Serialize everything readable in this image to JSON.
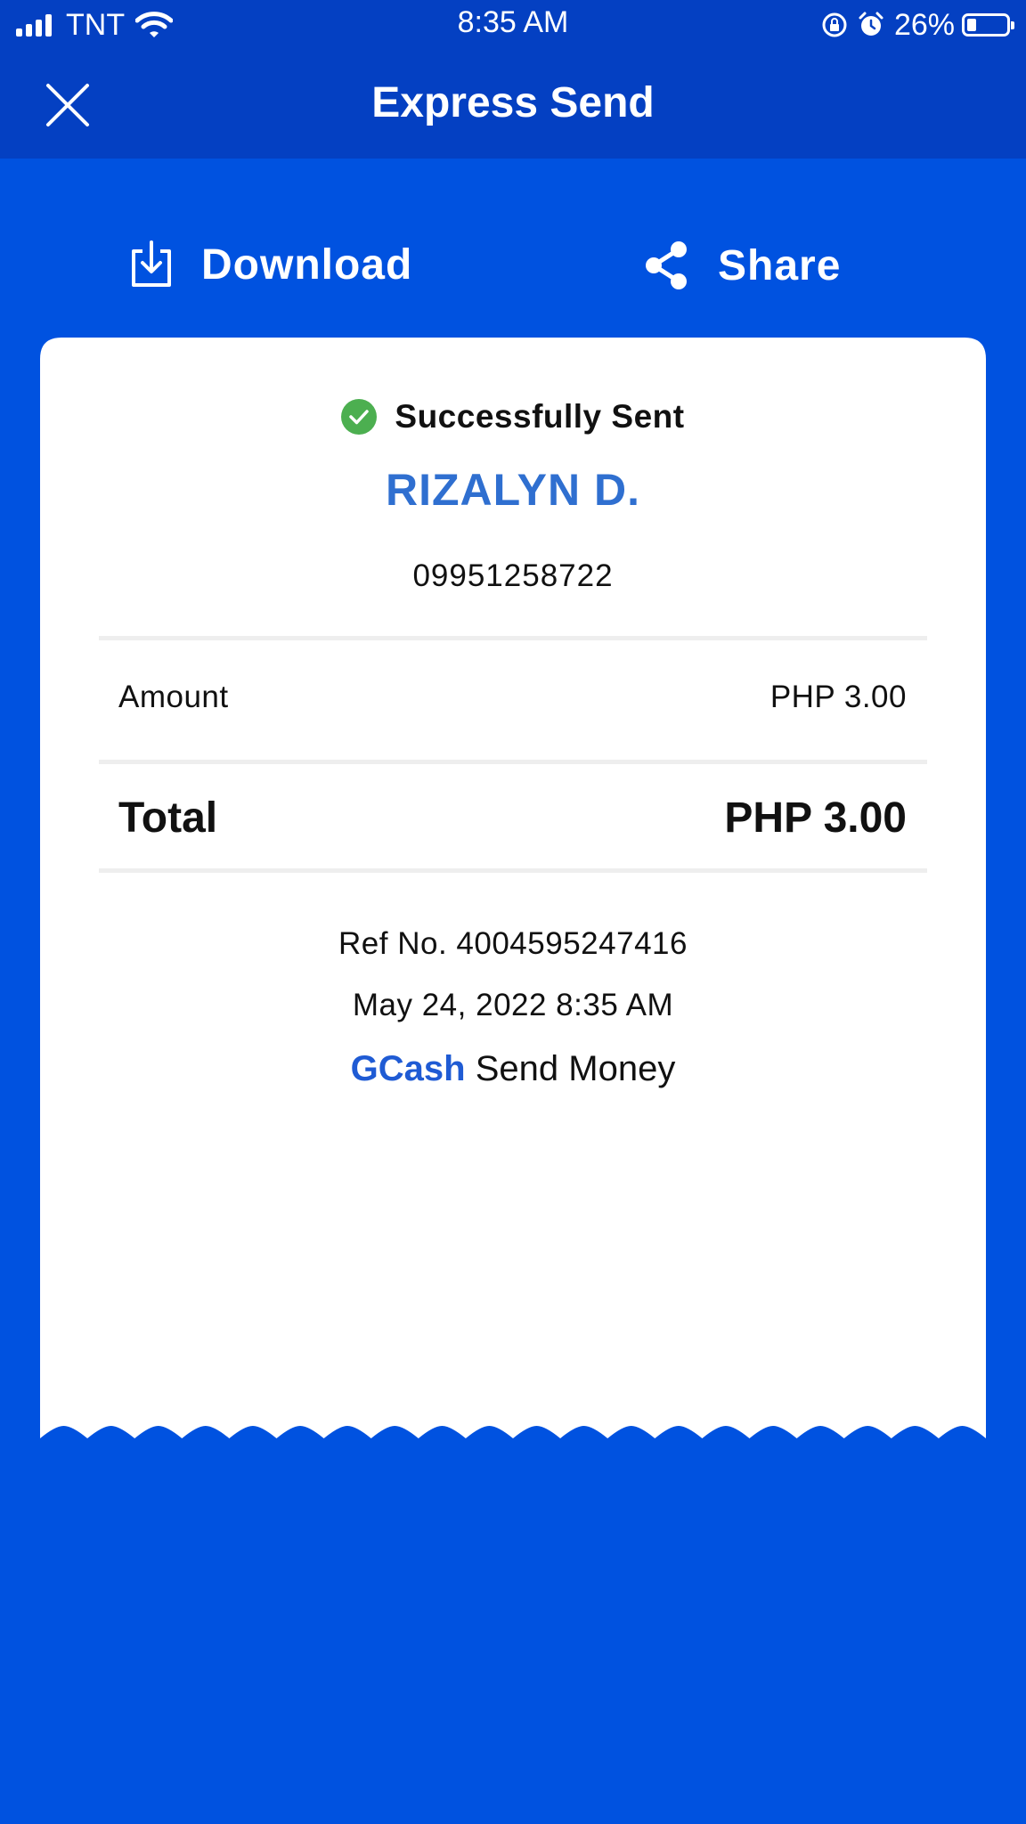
{
  "status_bar": {
    "carrier": "TNT",
    "time": "8:35 AM",
    "battery": "26%",
    "icons": [
      "signal-icon",
      "wifi-icon",
      "orientation-lock-icon",
      "alarm-icon",
      "battery-icon"
    ]
  },
  "header": {
    "title": "Express Send",
    "close_icon": "close-icon"
  },
  "actions": {
    "download_label": "Download",
    "share_label": "Share"
  },
  "receipt": {
    "status": "Successfully Sent",
    "recipient_name": "RIZALYN D.",
    "recipient_number": "09951258722",
    "amount_label": "Amount",
    "amount_value": "PHP 3.00",
    "total_label": "Total",
    "total_value": "PHP 3.00",
    "ref_no": "Ref No. 4004595247416",
    "datetime": "May 24, 2022 8:35 AM",
    "brand": "GCash",
    "service": "Send Money"
  },
  "colors": {
    "header_bg": "#0440c2",
    "page_bg": "#0052e0",
    "success_green": "#4caf50",
    "recipient_blue": "#2f6fd0"
  }
}
